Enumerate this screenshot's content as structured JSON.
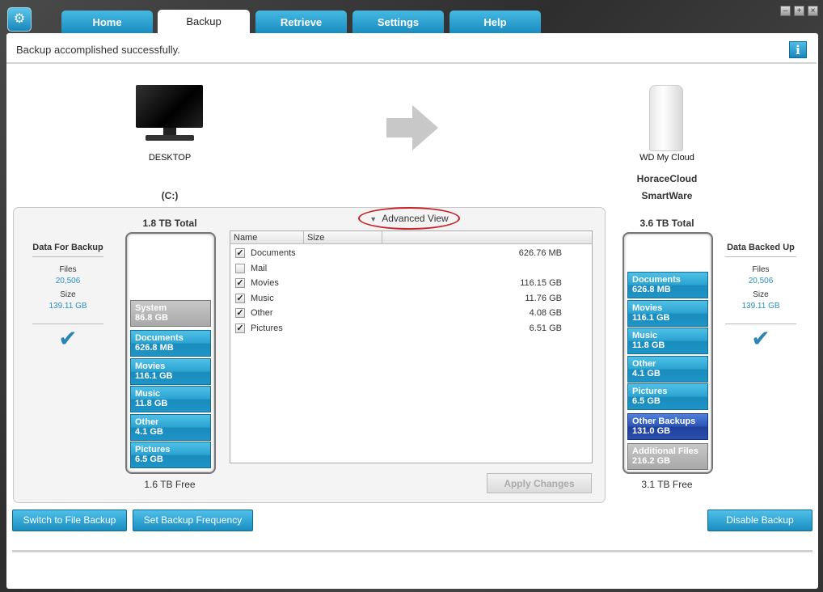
{
  "tabs": [
    {
      "label": "Home"
    },
    {
      "label": "Backup"
    },
    {
      "label": "Retrieve"
    },
    {
      "label": "Settings"
    },
    {
      "label": "Help"
    }
  ],
  "window_controls": {
    "minimize": "–",
    "maximize": "+",
    "close": "×"
  },
  "status": "Backup accomplished successfully.",
  "info_icon": "i",
  "source": {
    "name": "DESKTOP",
    "drive": "(C:)",
    "total": "1.8 TB Total",
    "free": "1.6 TB Free"
  },
  "destination": {
    "device": "WD My Cloud",
    "name": "HoraceCloud",
    "subname": "SmartWare",
    "total": "3.6 TB Total",
    "free": "3.1 TB Free"
  },
  "left_summary": {
    "title": "Data For Backup",
    "files_label": "Files",
    "files": "20,506",
    "size_label": "Size",
    "size": "139.11 GB"
  },
  "right_summary": {
    "title": "Data Backed Up",
    "files_label": "Files",
    "files": "20,506",
    "size_label": "Size",
    "size": "139.11 GB"
  },
  "left_segments": [
    {
      "name": "System",
      "size": "86.8 GB"
    },
    {
      "name": "Documents",
      "size": "626.8 MB"
    },
    {
      "name": "Movies",
      "size": "116.1 GB"
    },
    {
      "name": "Music",
      "size": "11.8 GB"
    },
    {
      "name": "Other",
      "size": "4.1 GB"
    },
    {
      "name": "Pictures",
      "size": "6.5 GB"
    }
  ],
  "right_segments": [
    {
      "name": "Documents",
      "size": "626.8 MB"
    },
    {
      "name": "Movies",
      "size": "116.1 GB"
    },
    {
      "name": "Music",
      "size": "11.8 GB"
    },
    {
      "name": "Other",
      "size": "4.1 GB"
    },
    {
      "name": "Pictures",
      "size": "6.5 GB"
    },
    {
      "name": "Other Backups",
      "size": "131.0 GB"
    },
    {
      "name": "Additional Files",
      "size": "216.2 GB"
    }
  ],
  "advanced_view": "Advanced View",
  "table": {
    "columns": [
      "Name",
      "Size"
    ],
    "rows": [
      {
        "name": "Documents",
        "size": "626.76 MB",
        "checked": true
      },
      {
        "name": "Mail",
        "size": "",
        "checked": false
      },
      {
        "name": "Movies",
        "size": "116.15 GB",
        "checked": true
      },
      {
        "name": "Music",
        "size": "11.76 GB",
        "checked": true
      },
      {
        "name": "Other",
        "size": "4.08 GB",
        "checked": true
      },
      {
        "name": "Pictures",
        "size": "6.51 GB",
        "checked": true
      }
    ]
  },
  "buttons": {
    "apply": "Apply Changes",
    "switch": "Switch to File Backup",
    "frequency": "Set Backup Frequency",
    "disable": "Disable Backup"
  }
}
